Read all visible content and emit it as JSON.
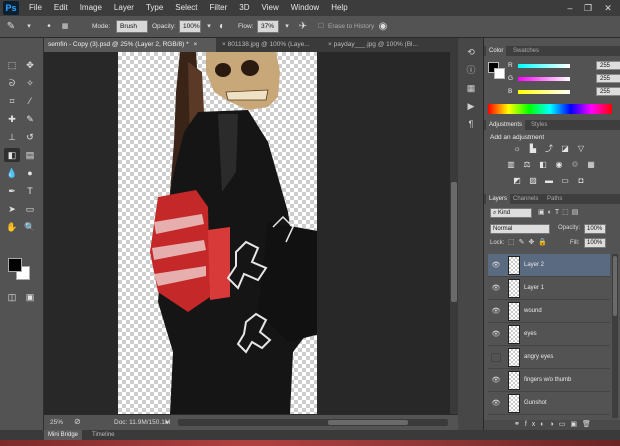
{
  "menubar": {
    "logo": "Ps",
    "items": [
      "File",
      "Edit",
      "Image",
      "Layer",
      "Type",
      "Select",
      "Filter",
      "3D",
      "View",
      "Window",
      "Help"
    ],
    "controls": [
      "–",
      "❐",
      "✕"
    ]
  },
  "options": {
    "mode_label": "Mode:",
    "mode_value": "Brush",
    "opacity_label": "Opacity:",
    "opacity_value": "100%",
    "flow_label": "Flow:",
    "flow_value": "37%",
    "erase_history_label": "Erase to History"
  },
  "document_tabs": [
    {
      "label": "semfin - Copy (3).psd @ 25% (Layer 2, RGB/8) *",
      "close": "×"
    },
    {
      "label": "801138.jpg @ 100% (Laye...",
      "close": "×"
    },
    {
      "label": "payday___.jpg @ 100% (Bl...",
      "close": "×"
    }
  ],
  "status": {
    "zoom": "25%",
    "doc_info": "Doc: 11.9M/150.1M"
  },
  "bottom_tabs": [
    "Mini Bridge",
    "Timeline"
  ],
  "color_panel": {
    "tabs": [
      "Color",
      "Swatches"
    ],
    "r_label": "R",
    "g_label": "G",
    "b_label": "B",
    "r_value": "255",
    "g_value": "255",
    "b_value": "255"
  },
  "adjustments_panel": {
    "tabs": [
      "Adjustments",
      "Styles"
    ],
    "heading": "Add an adjustment"
  },
  "layers_panel": {
    "tabs": [
      "Layers",
      "Channels",
      "Paths"
    ],
    "filter_kind": "Kind",
    "blend_mode": "Normal",
    "opacity_label": "Opacity:",
    "opacity_value": "100%",
    "lock_label": "Lock:",
    "fill_label": "Fill:",
    "fill_value": "100%",
    "layers": [
      {
        "name": "Layer 2",
        "visible": true,
        "selected": true
      },
      {
        "name": "Layer 1",
        "visible": true,
        "selected": false
      },
      {
        "name": "wound",
        "visible": true,
        "selected": false
      },
      {
        "name": "eyes",
        "visible": true,
        "selected": false
      },
      {
        "name": "angry eyes",
        "visible": false,
        "selected": false
      },
      {
        "name": "fingers w/o thumb",
        "visible": true,
        "selected": false
      },
      {
        "name": "Gunshot",
        "visible": true,
        "selected": false
      }
    ]
  },
  "colors": {
    "foreground": "#000000",
    "background": "#ffffff",
    "selected_layer": "#5a6a80"
  },
  "icons": {
    "tools": [
      "move-icon",
      "marquee-icon",
      "lasso-icon",
      "quick-select-icon",
      "crop-icon",
      "eyedropper-icon",
      "healing-icon",
      "brush-icon",
      "stamp-icon",
      "history-brush-icon",
      "eraser-icon",
      "gradient-icon",
      "blur-icon",
      "dodge-icon",
      "pen-icon",
      "type-icon",
      "path-select-icon",
      "shape-icon",
      "hand-icon",
      "zoom-icon"
    ]
  }
}
